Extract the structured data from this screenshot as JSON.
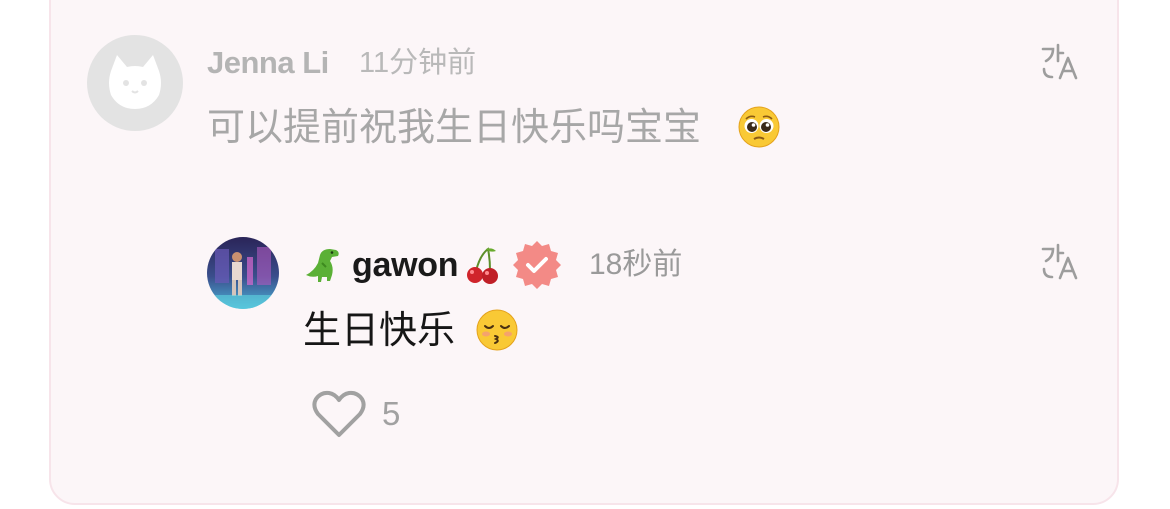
{
  "comment": {
    "author": "Jenna Li",
    "time": "11分钟前",
    "text": "可以提前祝我生日快乐吗宝宝",
    "emoji": "pleading-face"
  },
  "reply": {
    "author_prefix_emoji": "t-rex",
    "author": "gawon",
    "author_suffix_emoji": "cherries",
    "verified": true,
    "time": "18秒前",
    "text": "生日快乐",
    "emoji": "kissing-face-closed-eyes",
    "like_count": "5"
  },
  "colors": {
    "card_bg": "#fcf6f8",
    "card_border": "#f7e4ea",
    "verified_badge": "#f38a86",
    "muted_text": "#a7a7a7"
  }
}
